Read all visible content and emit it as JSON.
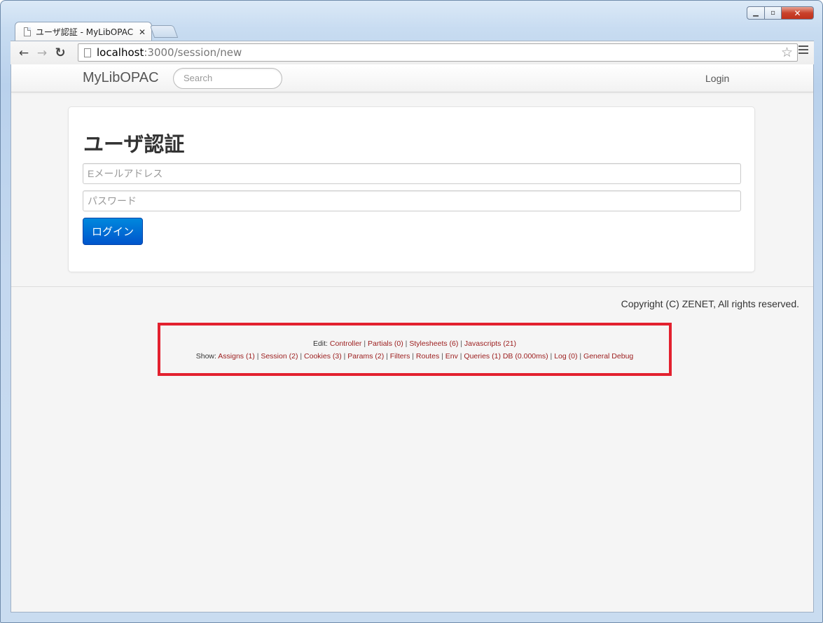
{
  "browser": {
    "tab_title": "ユーザ認証 - MyLibOPAC",
    "url_host": "localhost",
    "url_path": ":3000/session/new"
  },
  "navbar": {
    "brand": "MyLibOPAC",
    "search_placeholder": "Search",
    "login": "Login"
  },
  "form": {
    "title": "ユーザ認証",
    "email_placeholder": "Eメールアドレス",
    "password_placeholder": "パスワード",
    "submit_label": "ログイン"
  },
  "footer": {
    "copyright": "Copyright (C) ZENET, All rights reserved."
  },
  "debug": {
    "edit_label": "Edit:",
    "edit_links": [
      "Controller",
      "Partials (0)",
      "Stylesheets (6)",
      "Javascripts (21)"
    ],
    "show_label": "Show:",
    "show_links": [
      "Assigns (1)",
      "Session (2)",
      "Cookies (3)",
      "Params (2)",
      "Filters",
      "Routes",
      "Env",
      "Queries (1) DB (0.000ms)",
      "Log (0)",
      "General Debug"
    ]
  },
  "colors": {
    "primary_button": "#0066cc",
    "debug_border": "#e3212f",
    "debug_link": "#9b1c1c"
  }
}
